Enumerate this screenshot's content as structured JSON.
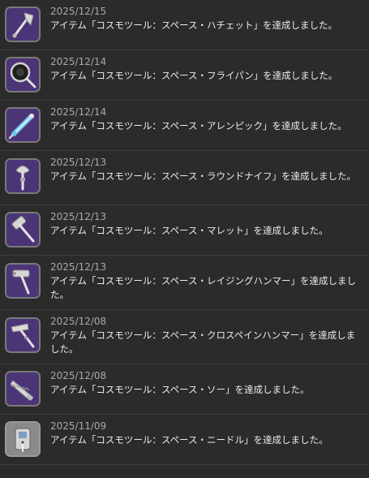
{
  "achievements": [
    {
      "date": "2025/12/15",
      "message": "アイテム「コスモツール：スペース・ハチェット」を達成しました。",
      "icon": "hatchet-icon"
    },
    {
      "date": "2025/12/14",
      "message": "アイテム「コスモツール：スペース・フライパン」を達成しました。",
      "icon": "frying-pan-icon"
    },
    {
      "date": "2025/12/14",
      "message": "アイテム「コスモツール：スペース・アレンピック」を達成しました。",
      "icon": "allen-pick-icon"
    },
    {
      "date": "2025/12/13",
      "message": "アイテム「コスモツール：スペース・ラウンドナイフ」を達成しました。",
      "icon": "round-knife-icon"
    },
    {
      "date": "2025/12/13",
      "message": "アイテム「コスモツール：スペース・マレット」を達成しました。",
      "icon": "mallet-icon"
    },
    {
      "date": "2025/12/13",
      "message": "アイテム「コスモツール：スペース・レイジングハンマー」を達成しました。",
      "icon": "raising-hammer-icon"
    },
    {
      "date": "2025/12/08",
      "message": "アイテム「コスモツール：スペース・クロスペインハンマー」を達成しました。",
      "icon": "cross-pein-hammer-icon"
    },
    {
      "date": "2025/12/08",
      "message": "アイテム「コスモツール：スペース・ソー」を達成しました。",
      "icon": "saw-icon"
    },
    {
      "date": "2025/11/09",
      "message": "アイテム「コスモツール：スペース・ニードル」を達成しました。",
      "icon": "needle-icon"
    }
  ],
  "colors": {
    "background": "#2b2b2b",
    "icon_frame": "#4c3577",
    "date_text": "#a9a9a9",
    "message_text": "#ececec"
  }
}
